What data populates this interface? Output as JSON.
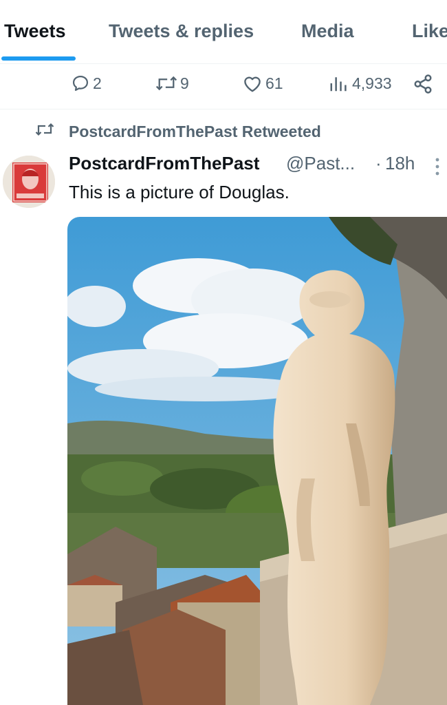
{
  "tabs": [
    {
      "label": "Tweets",
      "active": true
    },
    {
      "label": "Tweets & replies",
      "active": false
    },
    {
      "label": "Media",
      "active": false
    },
    {
      "label": "Like",
      "active": false
    }
  ],
  "actions": {
    "replies": "2",
    "retweets": "9",
    "likes": "61",
    "views": "4,933",
    "icons": [
      "reply-icon",
      "retweet-icon",
      "like-icon",
      "views-icon",
      "share-icon"
    ]
  },
  "tweet": {
    "retweet_label": "PostcardFromThePast Retweeted",
    "author_name": "PostcardFromThePast",
    "author_handle": "@Past...",
    "separator": "·",
    "time": "18h",
    "text": "This is a picture of Douglas."
  },
  "colors": {
    "accent": "#1d9bf0",
    "text_primary": "#0f1419",
    "text_secondary": "#536471",
    "divider": "#eff3f4"
  }
}
